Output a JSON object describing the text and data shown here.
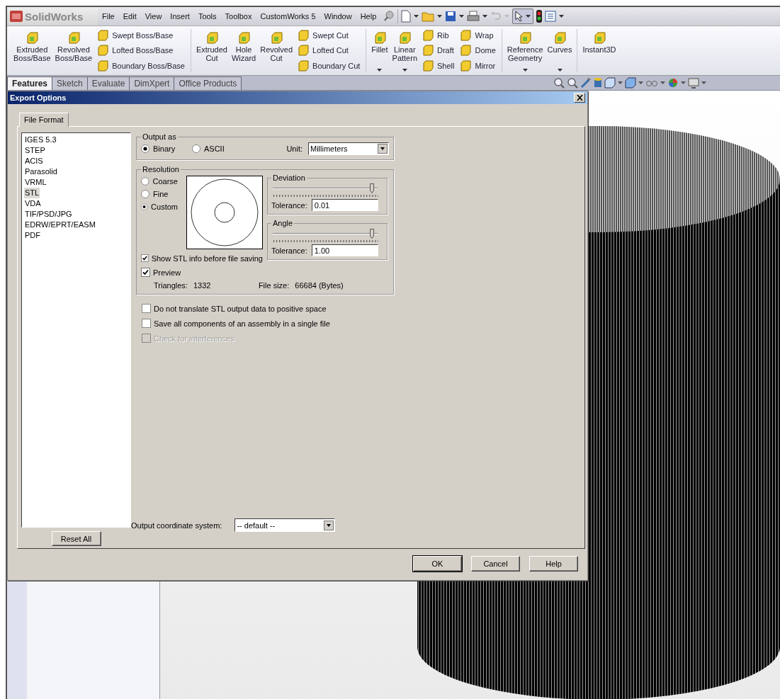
{
  "app": {
    "logo": "SolidWorks",
    "menu": [
      "File",
      "Edit",
      "View",
      "Insert",
      "Tools",
      "Toolbox",
      "CustomWorks 5",
      "Window",
      "Help"
    ]
  },
  "ribbon": [
    {
      "kind": "large",
      "label": "Extruded\nBoss/Base",
      "dropdown": false
    },
    {
      "kind": "large",
      "label": "Revolved\nBoss/Base",
      "dropdown": false
    },
    {
      "kind": "stack",
      "items": [
        "Swept Boss/Base",
        "Lofted Boss/Base",
        "Boundary Boss/Base"
      ]
    },
    {
      "kind": "separator"
    },
    {
      "kind": "large",
      "label": "Extruded\nCut",
      "dropdown": false
    },
    {
      "kind": "large",
      "label": "Hole\nWizard",
      "dropdown": false
    },
    {
      "kind": "large",
      "label": "Revolved\nCut",
      "dropdown": false
    },
    {
      "kind": "stack",
      "items": [
        "Swept Cut",
        "Lofted Cut",
        "Boundary Cut"
      ]
    },
    {
      "kind": "separator"
    },
    {
      "kind": "large",
      "label": "Fillet",
      "dropdown": true
    },
    {
      "kind": "large",
      "label": "Linear\nPattern",
      "dropdown": true
    },
    {
      "kind": "stack",
      "items": [
        "Rib",
        "Draft",
        "Shell"
      ]
    },
    {
      "kind": "stack",
      "items": [
        "Wrap",
        "Dome",
        "Mirror"
      ]
    },
    {
      "kind": "separator"
    },
    {
      "kind": "large",
      "label": "Reference\nGeometry",
      "dropdown": true
    },
    {
      "kind": "large",
      "label": "Curves",
      "dropdown": true
    },
    {
      "kind": "separator"
    },
    {
      "kind": "large",
      "label": "Instant3D",
      "dropdown": false
    }
  ],
  "command_tabs": [
    {
      "label": "Features",
      "selected": true
    },
    {
      "label": "Sketch",
      "selected": false
    },
    {
      "label": "Evaluate",
      "selected": false
    },
    {
      "label": "DimXpert",
      "selected": false
    },
    {
      "label": "Office Products",
      "selected": false
    }
  ],
  "dialog": {
    "title": "Export Options",
    "tabs": [
      {
        "label": "File Format",
        "selected": true
      }
    ],
    "formats": [
      {
        "label": "IGES 5.3",
        "selected": false
      },
      {
        "label": "STEP",
        "selected": false
      },
      {
        "label": "ACIS",
        "selected": false
      },
      {
        "label": "Parasolid",
        "selected": false
      },
      {
        "label": "VRML",
        "selected": false
      },
      {
        "label": "STL",
        "selected": true
      },
      {
        "label": "VDA",
        "selected": false
      },
      {
        "label": "TIF/PSD/JPG",
        "selected": false
      },
      {
        "label": "EDRW/EPRT/EASM",
        "selected": false
      },
      {
        "label": "PDF",
        "selected": false
      }
    ],
    "reset_button": "Reset All",
    "output_as": {
      "title": "Output as",
      "options": [
        {
          "label": "Binary",
          "selected": true
        },
        {
          "label": "ASCII",
          "selected": false
        }
      ],
      "unit_label": "Unit:",
      "unit_value": "Millimeters"
    },
    "resolution": {
      "title": "Resolution",
      "options": [
        {
          "label": "Coarse",
          "selected": false
        },
        {
          "label": "Fine",
          "selected": false
        },
        {
          "label": "Custom",
          "selected": true
        }
      ],
      "deviation": {
        "title": "Deviation",
        "level": 0.98,
        "tolerance_label": "Tolerance:",
        "tolerance_value": "0.01"
      },
      "angle": {
        "title": "Angle",
        "level": 0.98,
        "tolerance_label": "Tolerance:",
        "tolerance_value": "1.00"
      },
      "checks": [
        {
          "label": "Show STL info before file saving",
          "checked": true
        },
        {
          "label": "Preview",
          "checked": true
        }
      ],
      "triangles_label": "Triangles:",
      "triangles_value": "1332",
      "file_size_label": "File size:",
      "file_size_value": "66684 (Bytes)"
    },
    "options": [
      {
        "label": "Do not translate STL output data to positive space",
        "checked": false,
        "disabled": false
      },
      {
        "label": "Save all components of an assembly in a single file",
        "checked": false,
        "disabled": false
      },
      {
        "label": "Check for interferences",
        "checked": false,
        "disabled": true
      }
    ],
    "coordinate_label": "Output coordinate system:",
    "coordinate_value": "-- default --",
    "buttons": [
      "OK",
      "Cancel",
      "Help"
    ]
  }
}
